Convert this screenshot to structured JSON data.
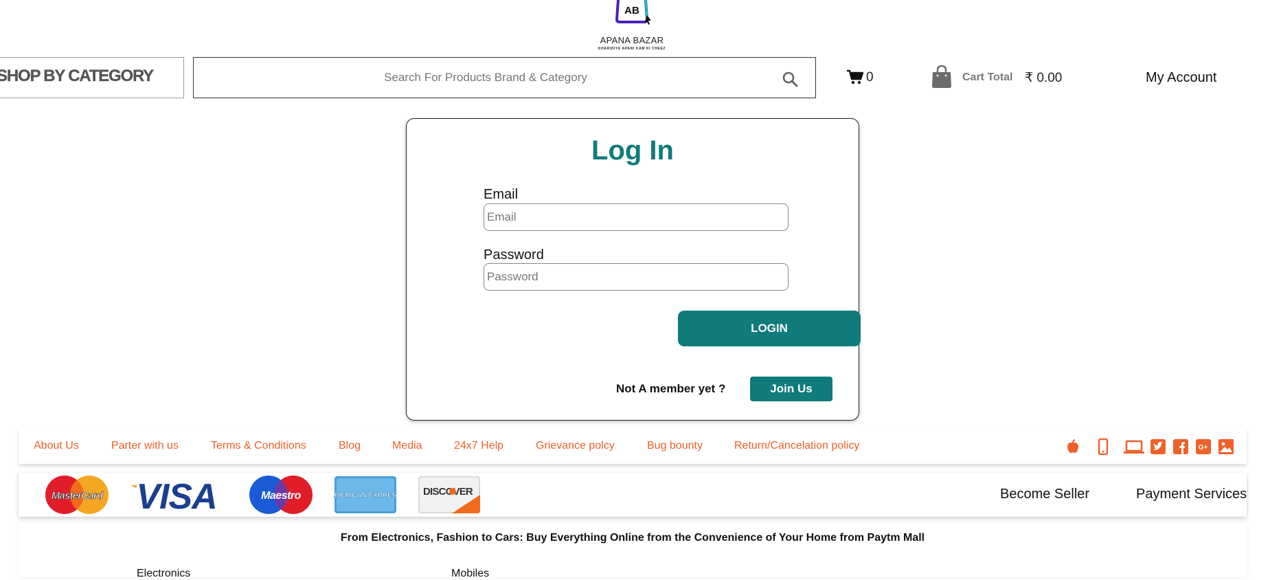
{
  "brand": {
    "name": "APANA BAZAR",
    "tagline": "KHARIDIYE APANI KAM KI CHEEZ",
    "logo_letters": "AB"
  },
  "header": {
    "category_label": "SHOP BY CATEGORY",
    "search_placeholder": "Search For Products Brand & Category",
    "cart_count": "0",
    "cart_total_label": "Cart Total",
    "cart_total_value": "₹ 0.00",
    "account_label": "My Account"
  },
  "login": {
    "title": "Log In",
    "email_label": "Email",
    "email_placeholder": "Email",
    "email_value": "",
    "password_label": "Password",
    "password_placeholder": "Password",
    "password_value": "",
    "login_button": "LOGIN",
    "member_prompt": "Not A member yet ?",
    "join_button": "Join Us"
  },
  "footer_links": [
    "About Us",
    "Parter with us",
    "Terms & Conditions",
    "Blog",
    "Media",
    "24x7 Help",
    "Grievance polcy",
    "Bug bounty",
    "Return/Cancelation policy"
  ],
  "social_icons": [
    "apple-icon",
    "mobile-icon",
    "laptop-icon",
    "twitter-icon",
    "facebook-icon",
    "google-plus-icon",
    "image-icon"
  ],
  "payment_logos": [
    "MasterCard",
    "VISA",
    "Maestro",
    "AMERICAN EXPRESS",
    "DISCOVER"
  ],
  "payment_links": [
    "Become Seller",
    "Payment Services"
  ],
  "info": {
    "tagline": "From Electronics, Fashion to Cars: Buy Everything Online from the Convenience of Your Home from Paytm Mall",
    "columns": [
      "Electronics",
      "Mobiles"
    ]
  },
  "colors": {
    "accent": "#0f7b7b",
    "footer_link": "#f0602a",
    "logo_purple": "#4b1fb8",
    "logo_teal": "#19c4b8"
  }
}
